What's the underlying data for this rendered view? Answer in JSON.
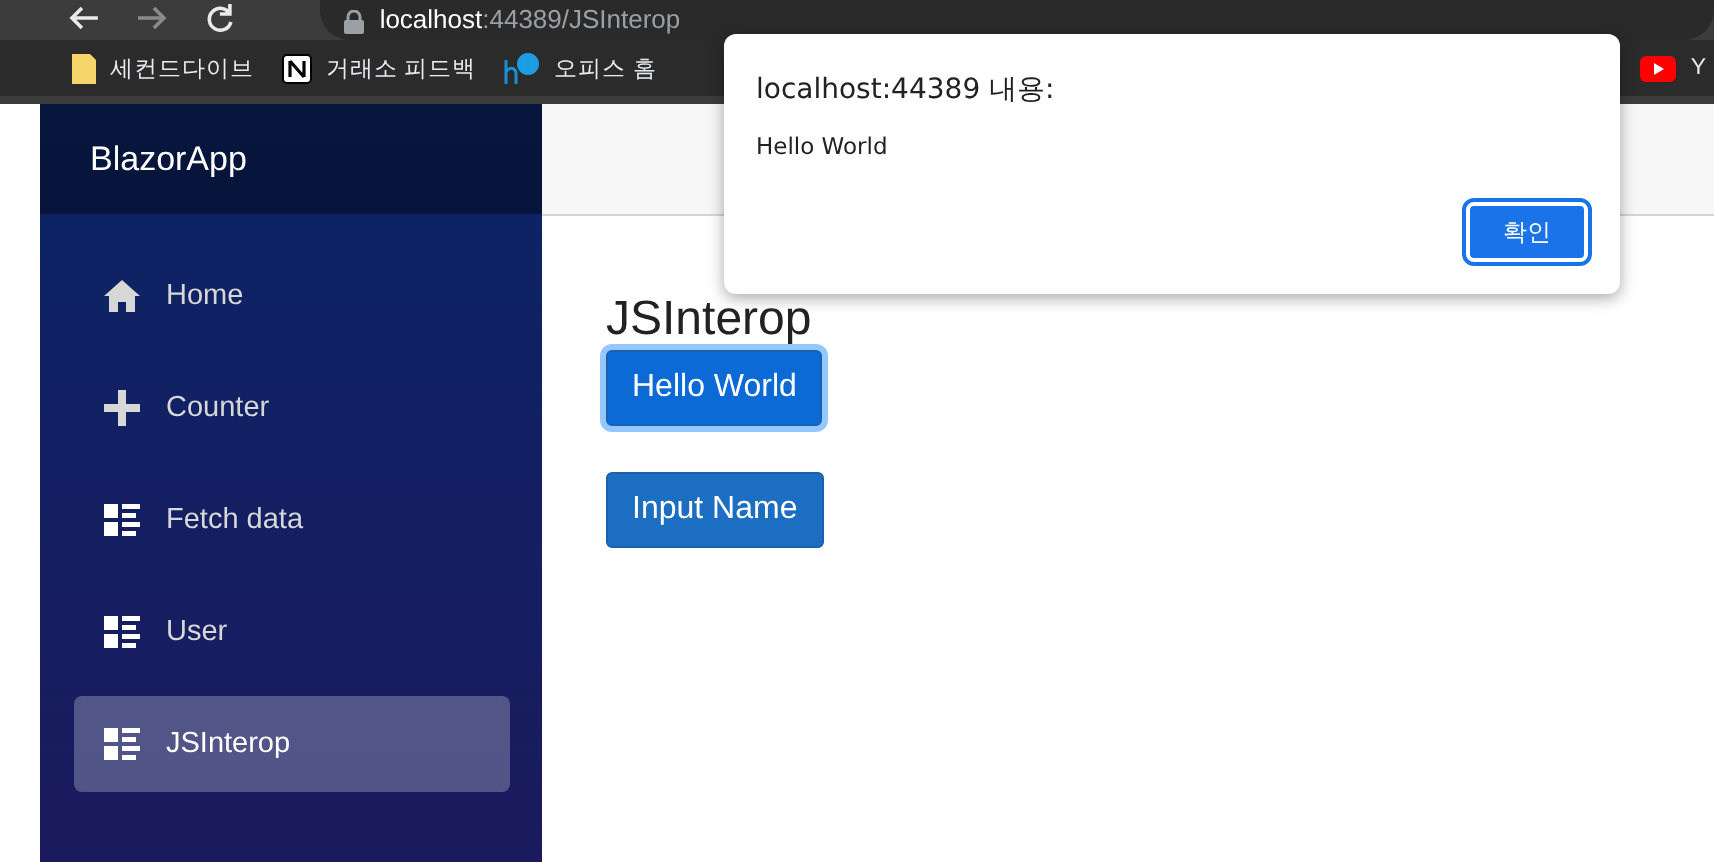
{
  "browser": {
    "url_host": "localhost",
    "url_path": ":44389/JSInterop",
    "bookmarks": [
      {
        "label": "세컨드다이브",
        "kind": "folder"
      },
      {
        "label": "거래소 피드백",
        "kind": "notion"
      },
      {
        "label": "오피스 홈",
        "kind": "office"
      },
      {
        "label": "Y",
        "kind": "youtube"
      }
    ]
  },
  "sidebar": {
    "brand": "BlazorApp",
    "items": [
      {
        "label": "Home",
        "kind": "home",
        "selected": false
      },
      {
        "label": "Counter",
        "kind": "plus",
        "selected": false
      },
      {
        "label": "Fetch data",
        "kind": "list",
        "selected": false
      },
      {
        "label": "User",
        "kind": "list",
        "selected": false
      },
      {
        "label": "JSInterop",
        "kind": "list",
        "selected": true
      }
    ]
  },
  "page": {
    "heading": "JSInterop",
    "buttons": [
      {
        "label": "Hello World",
        "focused": true
      },
      {
        "label": "Input Name",
        "focused": false
      }
    ]
  },
  "dialog": {
    "title": "localhost:44389 내용:",
    "message": "Hello World",
    "ok": "확인"
  }
}
